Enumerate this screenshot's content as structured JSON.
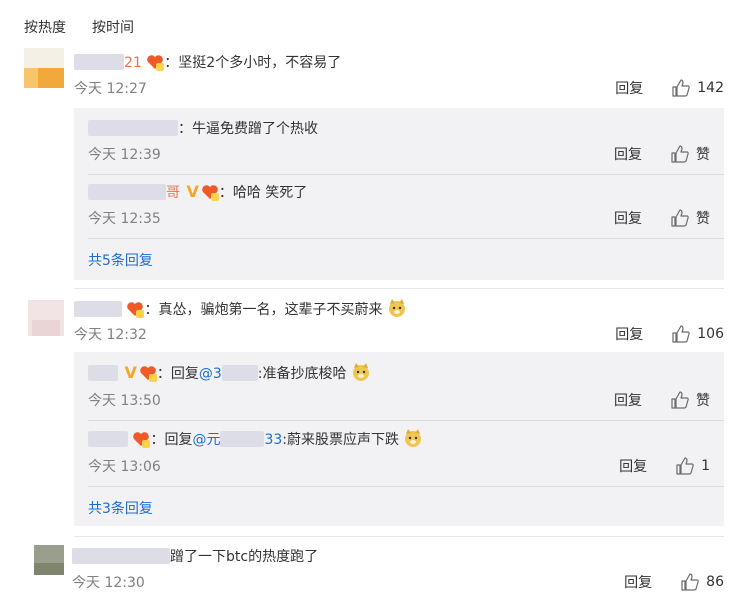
{
  "sort_tabs": [
    "按热度",
    "按时间"
  ],
  "ui": {
    "reply_label": "回复",
    "like_label": "赞"
  },
  "comments": [
    {
      "text": "坚挺2个多小时，不容易了",
      "name_visible": "21",
      "time": "今天 12:27",
      "likes": "142",
      "avatar_colors": [
        "#f5f0e6",
        "#f7c66a",
        "#f2a93b"
      ],
      "replies": [
        {
          "name_visible": "咖啡店长",
          "text": "牛逼免费蹭了个热收",
          "time": "今天 12:39"
        },
        {
          "name_visible": "哥",
          "text": "哈哈 笑死了",
          "time": "今天 12:35"
        }
      ],
      "more": "共5条回复"
    },
    {
      "text": "真怂，骗炮第一名，这辈子不买蔚来",
      "time": "今天 12:32",
      "likes": "106",
      "avatar_colors": [
        "#f2e4e4",
        "#e9d5d5"
      ],
      "replies": [
        {
          "name_visible": "言豫",
          "reply_prefix": "回复",
          "mention": "@3",
          "text": "准备抄底梭哈",
          "time": "今天 13:50"
        },
        {
          "name_visible": "豫",
          "reply_prefix": "回复",
          "mention": "@元",
          "mention_tail": "33",
          "text": "蔚来股票应声下跌",
          "time": "今天 13:06",
          "likes": "1"
        }
      ],
      "more": "共3条回复"
    },
    {
      "text": "蹭了一下btc的热度跑了",
      "time": "今天 12:30",
      "likes": "86",
      "avatar_colors": [
        "#9a9e8c",
        "#7f846f"
      ]
    }
  ]
}
